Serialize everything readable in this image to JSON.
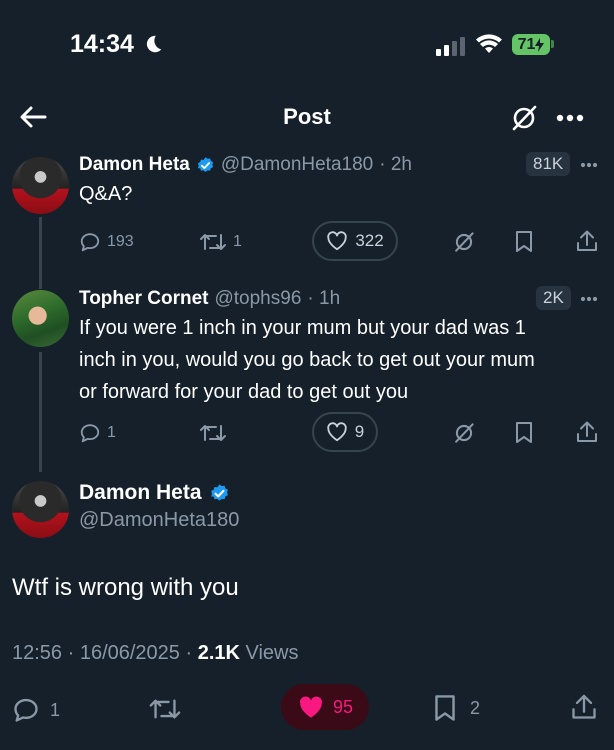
{
  "status_bar": {
    "time": "14:34",
    "battery": "71"
  },
  "header": {
    "title": "Post"
  },
  "tweet1": {
    "name": "Damon Heta",
    "handle": "@DamonHeta180",
    "time": "· 2h",
    "views_badge": "81K",
    "text": "Q&A?",
    "replies": "193",
    "retweets": "1",
    "likes": "322"
  },
  "tweet2": {
    "name": "Topher Cornet",
    "handle": "@tophs96",
    "time": "· 1h",
    "views_badge": "2K",
    "text_lines": [
      "If you were 1 inch in your mum but your dad was 1",
      "inch in you, would you go back to get out your mum",
      "or forward for your dad to get out you"
    ],
    "replies": "1",
    "likes": "9"
  },
  "main": {
    "name": "Damon Heta",
    "handle": "@DamonHeta180",
    "text": "Wtf is wrong with you",
    "timestamp": "12:56 · 16/06/2025 · ",
    "views_count": "2.1K",
    "views_label": " Views",
    "replies": "1",
    "likes": "95",
    "bookmarks": "2"
  },
  "colors": {
    "background": "#15202b",
    "verified": "#1d9bf0",
    "like": "#f91880",
    "battery": "#65c466"
  }
}
